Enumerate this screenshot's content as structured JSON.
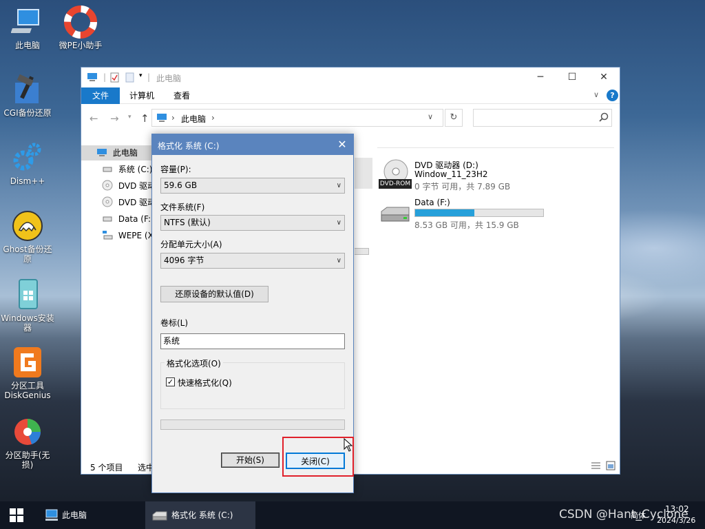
{
  "desktop": {
    "icons": [
      {
        "label": "此电脑",
        "icon": "computer-icon"
      },
      {
        "label": "微PE小助手",
        "icon": "lifebuoy-icon"
      },
      {
        "label": "CGI备份还原",
        "icon": "cgi-hammer-icon"
      },
      {
        "label": "Dism++",
        "icon": "gears-icon"
      },
      {
        "label": "Ghost备份还原",
        "icon": "ghost-icon"
      },
      {
        "label": "Windows安装器",
        "icon": "windows-installer-icon"
      },
      {
        "label": "分区工具DiskGenius",
        "icon": "diskgenius-icon"
      },
      {
        "label": "分区助手(无损)",
        "icon": "partition-assistant-icon"
      }
    ]
  },
  "explorer": {
    "title": "此电脑",
    "tabs": {
      "file": "文件",
      "computer": "计算机",
      "view": "查看"
    },
    "address": {
      "path": "此电脑",
      "separator": "›"
    },
    "nav": [
      {
        "label": "此电脑",
        "icon": "computer-icon"
      },
      {
        "label": "系统 (C:)",
        "icon": "drive-icon"
      },
      {
        "label": "DVD 驱动",
        "icon": "dvd-icon"
      },
      {
        "label": "DVD 驱动",
        "icon": "dvd-icon"
      },
      {
        "label": "Data (F:)",
        "icon": "drive-icon"
      },
      {
        "label": "WEPE (X",
        "icon": "network-drive-icon"
      }
    ],
    "drives": [
      {
        "name": "DVD 驱动器 (D:)",
        "volume": "Window_11_23H2",
        "space": "0 字节 可用，共 7.89 GB",
        "badge": "DVD-ROM",
        "icon": "dvd-icon"
      },
      {
        "name": "Data (F:)",
        "space": "8.53 GB 可用，共 15.9 GB",
        "used_fraction": 0.46,
        "bar_color": "#26a0da",
        "icon": "drive-icon"
      }
    ],
    "status": {
      "count": "5 个项目",
      "selected": "选中"
    }
  },
  "dialog": {
    "title": "格式化 系统 (C:)",
    "capacity_label": "容量(P):",
    "capacity_value": "59.6 GB",
    "fs_label": "文件系统(F)",
    "fs_value": "NTFS (默认)",
    "alloc_label": "分配单元大小(A)",
    "alloc_value": "4096 字节",
    "restore_button": "还原设备的默认值(D)",
    "volume_label": "卷标(L)",
    "volume_value": "系统",
    "options_label": "格式化选项(O)",
    "quick_format_label": "快速格式化(Q)",
    "quick_format_checked": true,
    "progress": 0,
    "start_button": "开始(S)",
    "close_button": "关闭(C)",
    "highlight_color": "#e0202a"
  },
  "taskbar": {
    "items": [
      {
        "label": "此电脑",
        "icon": "computer-icon"
      },
      {
        "label": "格式化 系统 (C:)",
        "icon": "drive-icon"
      }
    ],
    "time": "13:02",
    "date": "2024/3/26",
    "tray_text": "简体"
  },
  "watermark": "CSDN @Hant_Cyclone"
}
